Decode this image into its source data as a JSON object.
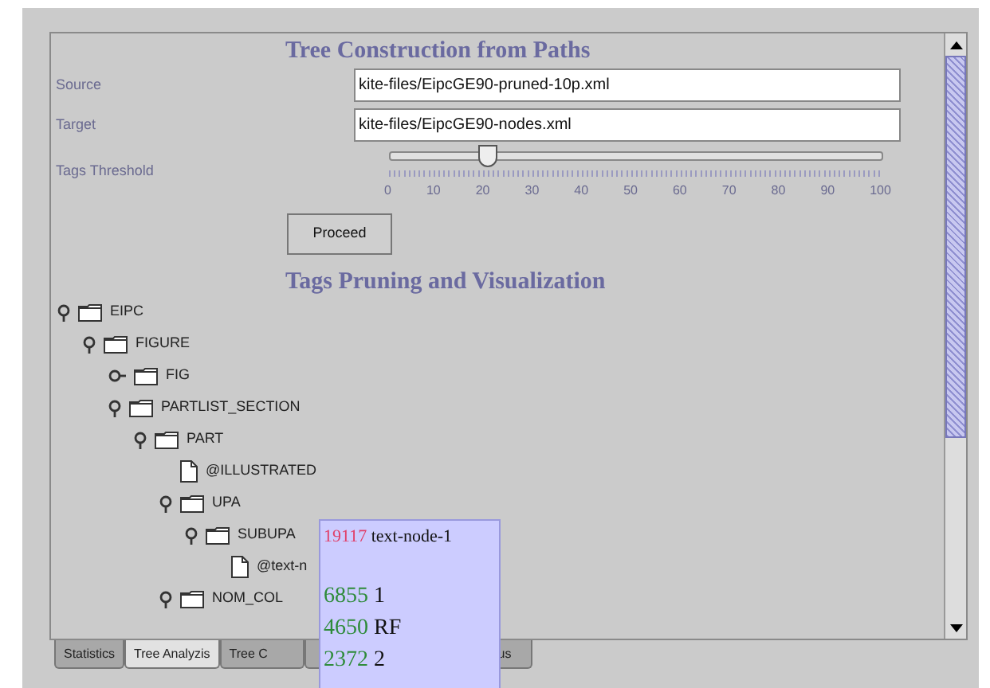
{
  "headings": [
    "Tree Construction from Paths",
    "Tags Pruning and Visualization"
  ],
  "fields": [
    {
      "label": "Source",
      "value": "kite-files/EipcGE90-pruned-10p.xml"
    },
    {
      "label": "Target",
      "value": "kite-files/EipcGE90-nodes.xml"
    }
  ],
  "threshold": {
    "label": "Tags Threshold",
    "level": 0.2,
    "ticks": [
      "0",
      "10",
      "20",
      "30",
      "40",
      "50",
      "60",
      "70",
      "80",
      "90",
      "100"
    ]
  },
  "proceed_button": "Proceed",
  "tree": [
    {
      "label": "EIPC",
      "kind": "folder",
      "expanded": true,
      "children": [
        {
          "label": "FIGURE",
          "kind": "folder",
          "expanded": true,
          "children": [
            {
              "label": "FIG",
              "kind": "folder",
              "expanded": false
            },
            {
              "label": "PARTLIST_SECTION",
              "kind": "folder",
              "expanded": true,
              "children": [
                {
                  "label": "PART",
                  "kind": "folder",
                  "expanded": true,
                  "children": [
                    {
                      "label": "@ILLUSTRATED",
                      "kind": "leaf"
                    },
                    {
                      "label": "UPA",
                      "kind": "folder",
                      "expanded": true,
                      "children": [
                        {
                          "label": "SUBUPA",
                          "kind": "folder",
                          "expanded": true,
                          "children": [
                            {
                              "label": "@text-n",
                              "kind": "leaf"
                            }
                          ]
                        }
                      ]
                    },
                    {
                      "label": "NOM_COL",
                      "kind": "folder",
                      "expanded": true
                    }
                  ]
                }
              ]
            }
          ]
        }
      ]
    }
  ],
  "tooltip": [
    {
      "count": "19117",
      "label": "text-node-1",
      "color": "#e0406a"
    },
    {
      "count": "6855",
      "label": "1",
      "color": "#2e8b3a"
    },
    {
      "count": "4650",
      "label": "RF",
      "color": "#2e8b3a"
    },
    {
      "count": "2372",
      "label": "2",
      "color": "#2e8b3a"
    }
  ],
  "tabs": [
    {
      "label": "Statistics",
      "selected": false
    },
    {
      "label": "Tree Analyzis",
      "selected": true
    },
    {
      "label": "Tree C",
      "selected": false
    },
    {
      "label": "us",
      "selected": false
    }
  ]
}
